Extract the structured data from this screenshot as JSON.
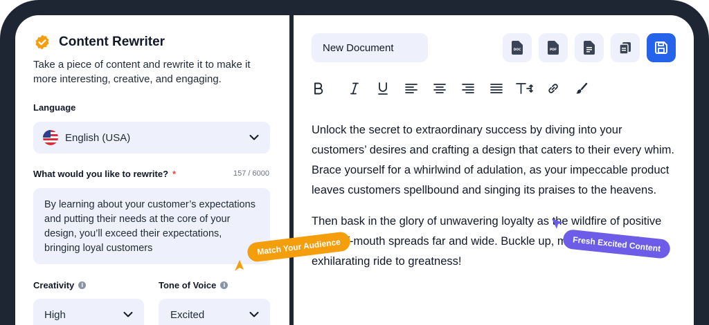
{
  "left": {
    "title": "Content Rewriter",
    "description": "Take a piece of content and rewrite it to make it more interesting, creative, and engaging.",
    "language_label": "Language",
    "language_value": "English (USA)",
    "rewrite_label": "What would you like to rewrite?",
    "required_mark": "*",
    "char_count": "157 / 6000",
    "rewrite_text": "By learning about your customer’s expectations and putting their needs at the core of your design, you’ll exceed their expectations, bringing loyal customers",
    "creativity_label": "Creativity",
    "creativity_value": "High",
    "tone_label": "Tone of Voice",
    "tone_value": "Excited"
  },
  "right": {
    "doc_title": "New Document",
    "actions": [
      "doc-export",
      "pdf-export",
      "text-export",
      "copy",
      "save"
    ],
    "format_tools": [
      "bold",
      "italic",
      "underline",
      "align-left",
      "align-center",
      "align-right",
      "justify",
      "text-size",
      "link",
      "brush"
    ],
    "paragraph1": "Unlock the secret to extraordinary success by diving into your customers’ desires and crafting a design that caters to their every whim. Brace yourself for a whirlwind of adulation, as your impeccable product leaves customers spellbound and singing its praises to the heavens.",
    "paragraph2": "Then bask in the glory of unwavering loyalty as the wildfire of positive word-of-mouth spreads far and wide. Buckle up, my friend, for this exhilarating ride to greatness!"
  },
  "callouts": {
    "audience": "Match Your Audience",
    "fresh": "Fresh Excited Content"
  },
  "icons": {
    "doc_label": "DOC",
    "pdf_label": "PDF"
  },
  "colors": {
    "frame": "#1f2633",
    "accent": "#2563eb",
    "orange": "#f59e0b",
    "purple": "#6d5ce8",
    "field_bg": "#eef1fb"
  }
}
